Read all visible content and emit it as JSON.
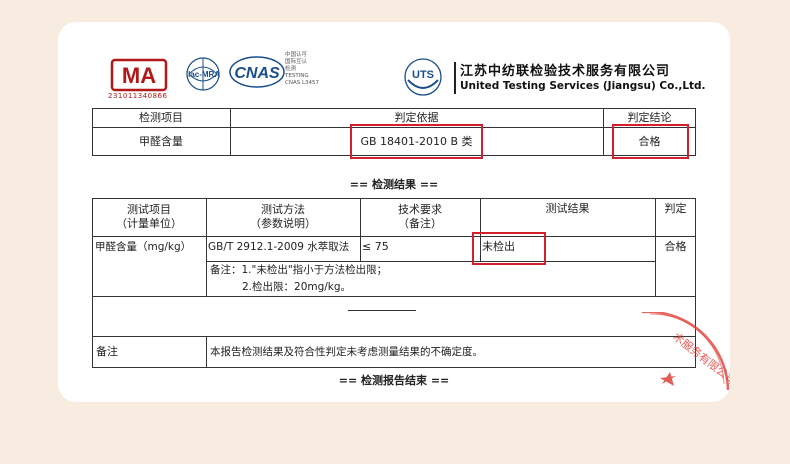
{
  "logos": {
    "cma_text": "MA",
    "cma_number": "231011340866",
    "ilac_text": "ilac-MRA",
    "cnas_text": "CNAS",
    "cnas_side": [
      "中国认可",
      "国际互认",
      "检测",
      "TESTING",
      "CNAS L3457"
    ],
    "uts_text": "UTS"
  },
  "company": {
    "name_cn": "江苏中纺联检验技术服务有限公司",
    "name_en": "United Testing Services (Jiangsu) Co.,Ltd."
  },
  "table1": {
    "headers": [
      "检测项目",
      "判定依据",
      "判定结论"
    ],
    "row": [
      "甲醛含量",
      "GB 18401-2010 B 类",
      "合格"
    ]
  },
  "section_results": "== 检测结果 ==",
  "table2": {
    "headers": {
      "item": "测试项目",
      "item_sub": "（计量单位）",
      "method": "测试方法",
      "method_sub": "（参数说明）",
      "requirement": "技术要求",
      "requirement_sub": "（备注）",
      "result": "测试结果",
      "judgement": "判定"
    },
    "row": {
      "item": "甲醛含量（mg/kg）",
      "method": "GB/T 2912.1-2009 水萃取法",
      "requirement": "≤ 75",
      "result": "未检出",
      "judgement": "合格"
    },
    "note_line1": "备注：1.\"未检出\"指小于方法检出限；",
    "note_line2": "2.检出限：20mg/kg。",
    "remark_label": "备注",
    "remark_text": "本报告检测结果及符合性判定未考虑测量结果的不确定度。"
  },
  "section_end": "== 检测报告结束 ==",
  "stamp_text": "术服务有限公司",
  "colors": {
    "stamp_red": "#e0403a",
    "box_red": "#d3202e",
    "cma_red": "#b01919",
    "cnas_blue": "#1a4e8a"
  }
}
